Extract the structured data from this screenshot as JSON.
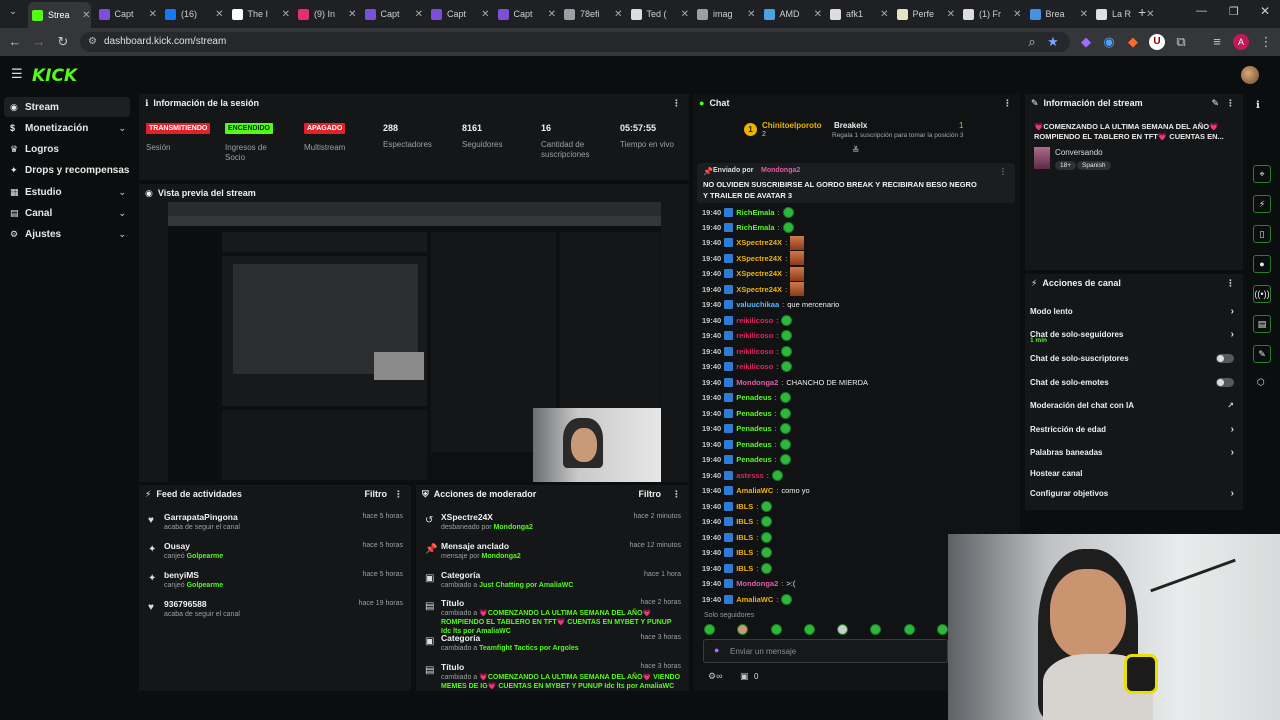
{
  "browser": {
    "tabs": [
      {
        "label": "Strea",
        "active": true,
        "color": "#53fc18"
      },
      {
        "label": "Capt",
        "color": "#7b4fd6"
      },
      {
        "label": "(16) ",
        "color": "#1877f2"
      },
      {
        "label": "The I",
        "color": "#ffffff"
      },
      {
        "label": "(9) In",
        "color": "#e1306c"
      },
      {
        "label": "Capt",
        "color": "#7b4fd6"
      },
      {
        "label": "Capt",
        "color": "#7b4fd6"
      },
      {
        "label": "Capt",
        "color": "#7b4fd6"
      },
      {
        "label": "78efi",
        "color": "#9aa0a6"
      },
      {
        "label": "Ted (",
        "color": "#dddddd"
      },
      {
        "label": "imag",
        "color": "#9aa0a6"
      },
      {
        "label": "AMD",
        "color": "#4aa3df"
      },
      {
        "label": "afk1",
        "color": "#dddddd"
      },
      {
        "label": "Perfe",
        "color": "#e8e1c4"
      },
      {
        "label": "(1) Fr",
        "color": "#dddddd"
      },
      {
        "label": "Brea",
        "color": "#4a90e2"
      },
      {
        "label": "La R",
        "color": "#e0e0e0"
      }
    ],
    "url": "dashboard.kick.com/stream",
    "profile_initial": "A"
  },
  "brand": {
    "logo": "KICK",
    "accent": "#53fc18"
  },
  "sidebar": {
    "items": [
      {
        "label": "Stream",
        "icon": "broadcast-icon",
        "active": true
      },
      {
        "label": "Monetización",
        "icon": "dollar-icon",
        "chevron": true
      },
      {
        "label": "Logros",
        "icon": "trophy-icon"
      },
      {
        "label": "Drops y recompensas",
        "icon": "gift-icon"
      },
      {
        "label": "Estudio",
        "icon": "studio-icon",
        "chevron": true
      },
      {
        "label": "Canal",
        "icon": "channel-icon",
        "chevron": true
      },
      {
        "label": "Ajustes",
        "icon": "gear-icon",
        "chevron": true
      }
    ]
  },
  "session": {
    "title": "Información de la sesión",
    "badges": [
      {
        "text": "TRANSMITIENDO",
        "label": "Sesión",
        "bg": "#e0222d",
        "fg": "#ffffff"
      },
      {
        "text": "ENCENDIDO",
        "label": "Ingresos de Socio",
        "bg": "#53fc18",
        "fg": "#0b2a06"
      },
      {
        "text": "APAGADO",
        "label": "Multistream",
        "bg": "#e0222d",
        "fg": "#ffffff"
      }
    ],
    "stats": [
      {
        "value": "288",
        "label": "Espectadores"
      },
      {
        "value": "8161",
        "label": "Seguidores"
      },
      {
        "value": "16",
        "label": "Cantidad de suscripciones"
      },
      {
        "value": "05:57:55",
        "label": "Tiempo en vivo"
      }
    ]
  },
  "preview": {
    "title": "Vista previa del stream"
  },
  "feed": {
    "title": "Feed de actividades",
    "filter": "Filtro",
    "items": [
      {
        "icon": "heart-icon",
        "user": "GarrapataPingona",
        "action": "acaba de seguir el canal",
        "extra": "",
        "time": "hace 5 horas"
      },
      {
        "icon": "gift-icon",
        "user": "Ousay",
        "action": "canjeó",
        "extra": "Golpearme",
        "time": "hace 5 horas"
      },
      {
        "icon": "gift-icon",
        "user": "benyiMS",
        "action": "canjeó",
        "extra": "Golpearme",
        "time": "hace 5 horas"
      },
      {
        "icon": "heart-icon",
        "user": "936796588",
        "action": "acaba de seguir el canal",
        "extra": "",
        "time": "hace 19 horas"
      }
    ]
  },
  "modactions": {
    "title": "Acciones de moderador",
    "filter": "Filtro",
    "items": [
      {
        "icon": "unban-icon",
        "title": "XSpectre24X",
        "sub": "desbaneado por",
        "who": "Mondonga2",
        "time": "hace 2 minutos"
      },
      {
        "icon": "pin-icon",
        "title": "Mensaje anclado",
        "sub": "mensaje por",
        "who": "Mondonga2",
        "time": "hace 12 minutos"
      },
      {
        "icon": "category-icon",
        "title": "Categoría",
        "sub": "cambiado a",
        "who": "Just Chatting por AmaliaWC",
        "time": "hace 1 hora"
      },
      {
        "icon": "title-icon",
        "title": "Título",
        "sub": "cambiado a",
        "who": "💗COMENZANDO LA ULTIMA SEMANA DEL AÑO💗 ROMPIENDO EL TABLERO EN TFT💗 CUENTAS EN MYBET Y PUNUP Idc lts por AmaliaWC",
        "time": "hace 2 horas"
      },
      {
        "icon": "category-icon",
        "title": "Categoría",
        "sub": "cambiado a",
        "who": "Teamfight Tactics por Argoles",
        "time": "hace 3 horas"
      },
      {
        "icon": "title-icon",
        "title": "Título",
        "sub": "cambiado a",
        "who": "💗COMENZANDO LA ULTIMA SEMANA DEL AÑO💗 VIENDO MEMES DE IG💗 CUENTAS EN MYBET Y PUNUP Idc lts por AmaliaWC",
        "time": "hace 3 horas"
      }
    ]
  },
  "chat": {
    "title": "Chat",
    "top_gifter": {
      "user": "Chinitoelporoto",
      "count": "2",
      "gift_user": "Breakelx",
      "gift_count": "1",
      "gift_text": "Regala 1 suscripción para tomar la posición 3"
    },
    "pinned": {
      "label": "Enviado por",
      "by": "Mondonga2",
      "text": "NO OLVIDEN SUSCRIBIRSE AL GORDO BREAK Y RECIBIRAN BESO NEGRO Y TRAILER DE AVATAR 3"
    },
    "messages": [
      {
        "time": "19:40",
        "user": "RichEmala",
        "color": "#53fc18",
        "text": "",
        "emote": true
      },
      {
        "time": "19:40",
        "user": "RichEmala",
        "color": "#53fc18",
        "text": "",
        "emote": true
      },
      {
        "time": "19:40",
        "user": "XSpectre24X",
        "color": "#f0b400",
        "text": "",
        "emote": false,
        "img": true
      },
      {
        "time": "19:40",
        "user": "XSpectre24X",
        "color": "#f0b400",
        "text": "",
        "emote": false,
        "img": true
      },
      {
        "time": "19:40",
        "user": "XSpectre24X",
        "color": "#f0b400",
        "text": "",
        "emote": false,
        "img": true
      },
      {
        "time": "19:40",
        "user": "XSpectre24X",
        "color": "#f0b400",
        "text": "",
        "emote": false,
        "img": true
      },
      {
        "time": "19:40",
        "user": "valuuchikaa",
        "color": "#5ab8ff",
        "text": "que mercenario",
        "emote": false
      },
      {
        "time": "19:40",
        "user": "reikilicoso",
        "color": "#e0245e",
        "text": "",
        "emote": true
      },
      {
        "time": "19:40",
        "user": "reikilicoso",
        "color": "#e0245e",
        "text": "",
        "emote": true
      },
      {
        "time": "19:40",
        "user": "reikilicoso",
        "color": "#e0245e",
        "text": "",
        "emote": true
      },
      {
        "time": "19:40",
        "user": "reikilicoso",
        "color": "#e0245e",
        "text": "",
        "emote": true
      },
      {
        "time": "19:40",
        "user": "Mondonga2",
        "color": "#e05ca4",
        "text": "CHANCHO DE MIERDA",
        "emote": false
      },
      {
        "time": "19:40",
        "user": "Penadeus",
        "color": "#53fc18",
        "text": "",
        "emote": true
      },
      {
        "time": "19:40",
        "user": "Penadeus",
        "color": "#53fc18",
        "text": "",
        "emote": true
      },
      {
        "time": "19:40",
        "user": "Penadeus",
        "color": "#53fc18",
        "text": "",
        "emote": true
      },
      {
        "time": "19:40",
        "user": "Penadeus",
        "color": "#53fc18",
        "text": "",
        "emote": true
      },
      {
        "time": "19:40",
        "user": "Penadeus",
        "color": "#53fc18",
        "text": "",
        "emote": true
      },
      {
        "time": "19:40",
        "user": "astesss",
        "color": "#e0245e",
        "text": "",
        "emote": true
      },
      {
        "time": "19:40",
        "user": "AmaliaWC",
        "color": "#f0b400",
        "text": "como yo",
        "emote": false
      },
      {
        "time": "19:40",
        "user": "IBLS",
        "color": "#f0b400",
        "text": "",
        "emote": true
      },
      {
        "time": "19:40",
        "user": "IBLS",
        "color": "#f0b400",
        "text": "",
        "emote": true
      },
      {
        "time": "19:40",
        "user": "IBLS",
        "color": "#f0b400",
        "text": "",
        "emote": true
      },
      {
        "time": "19:40",
        "user": "IBLS",
        "color": "#f0b400",
        "text": "",
        "emote": true
      },
      {
        "time": "19:40",
        "user": "IBLS",
        "color": "#f0b400",
        "text": "",
        "emote": true
      },
      {
        "time": "19:40",
        "user": "Mondonga2",
        "color": "#e05ca4",
        "text": ">:(",
        "emote": false
      },
      {
        "time": "19:40",
        "user": "AmaliaWC",
        "color": "#f0b400",
        "text": "",
        "emote": true
      }
    ],
    "followers_only": "Solo seguidores",
    "input_placeholder": "Enviar un mensaje",
    "footer_count": "0"
  },
  "stream_info": {
    "title": "Información del stream",
    "stream_title": "💗COMENZANDO LA ULTIMA SEMANA DEL AÑO💗 ROMPIENDO EL TABLERO EN TFT💗 CUENTAS EN...",
    "category": "Conversando",
    "tags": [
      "18+",
      "Spanish"
    ]
  },
  "channel_actions": {
    "title": "Acciones de canal",
    "items": [
      {
        "label": "Modo lento",
        "type": "arrow",
        "sub": ""
      },
      {
        "label": "Chat de solo-seguidores",
        "type": "arrow",
        "sub": "1 min"
      },
      {
        "label": "Chat de solo-suscriptores",
        "type": "toggle",
        "sub": ""
      },
      {
        "label": "Chat de solo-emotes",
        "type": "toggle",
        "sub": ""
      },
      {
        "label": "Moderación del chat con IA",
        "type": "external",
        "sub": ""
      },
      {
        "label": "Restricción de edad",
        "type": "arrow",
        "sub": ""
      },
      {
        "label": "Palabras baneadas",
        "type": "arrow",
        "sub": ""
      },
      {
        "label": "Hostear canal",
        "type": "none",
        "sub": ""
      },
      {
        "label": "Configurar objetivos",
        "type": "arrow",
        "sub": ""
      }
    ]
  }
}
